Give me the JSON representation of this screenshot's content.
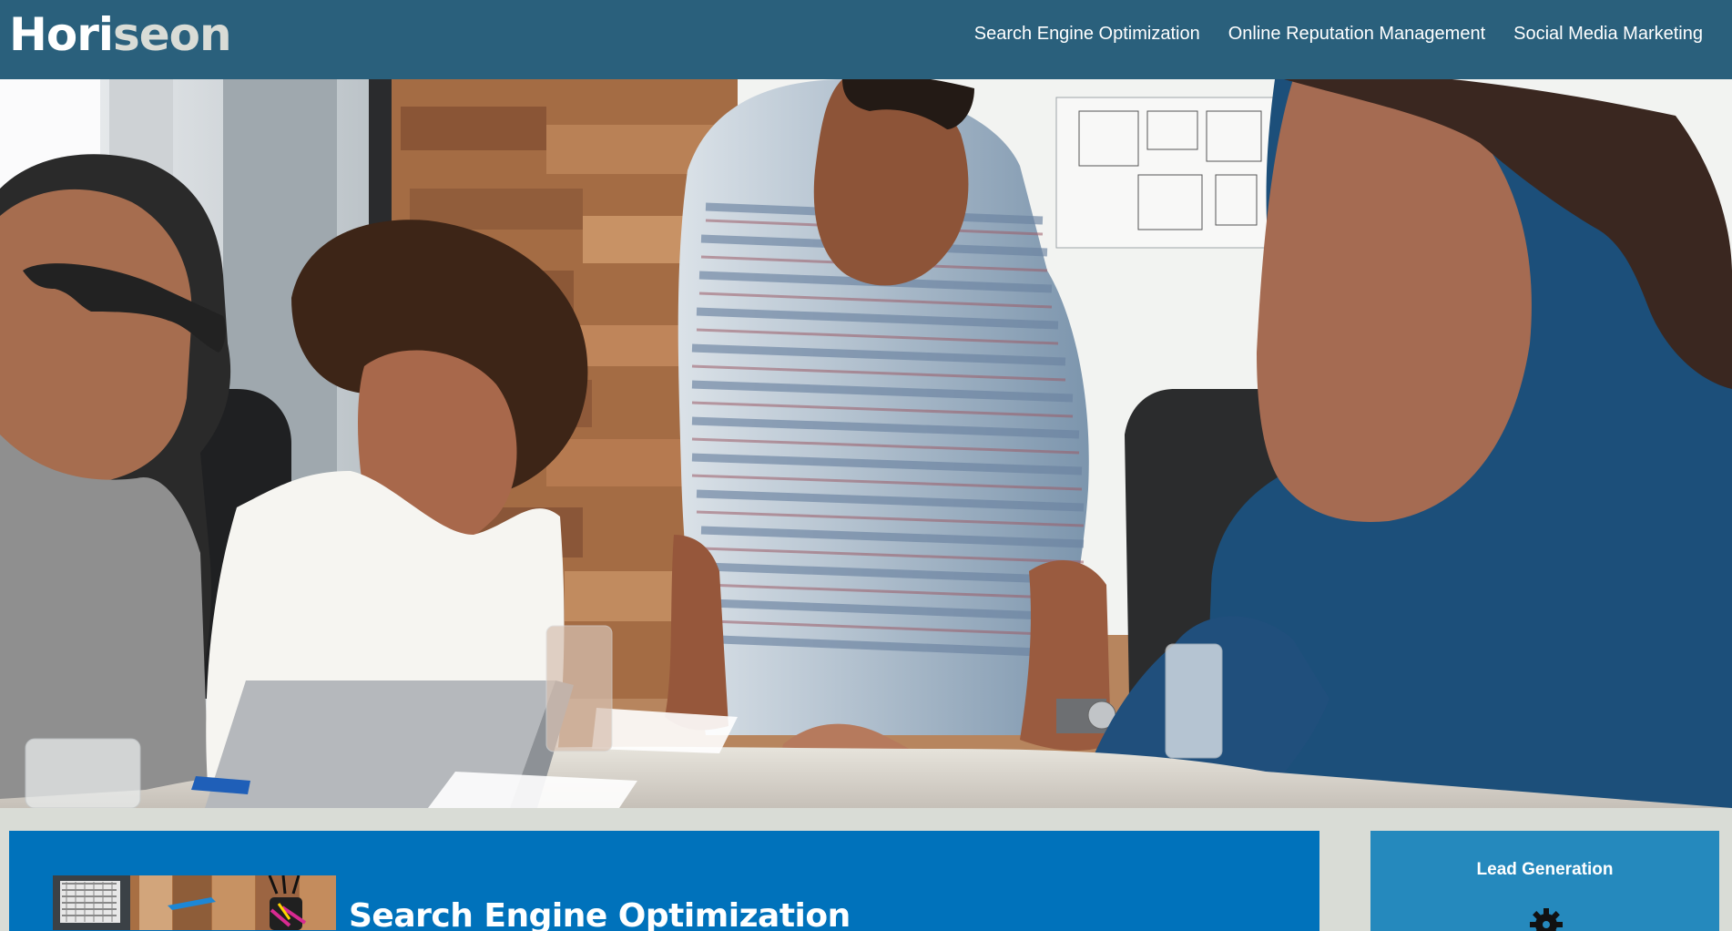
{
  "header": {
    "logo": {
      "main": "Hori",
      "accent": "seon"
    },
    "nav": [
      {
        "label": "Search Engine Optimization"
      },
      {
        "label": "Online Reputation Management"
      },
      {
        "label": "Social Media Marketing"
      }
    ]
  },
  "hero": {
    "image": "team-meeting-photo"
  },
  "content": {
    "title": "Search Engine Optimization",
    "image": "seo-desk-photo"
  },
  "aside": {
    "title": "Lead Generation",
    "icon": "gear-icon"
  },
  "colors": {
    "header_bg": "#2a607c",
    "content_bg": "#0072bb",
    "aside_bg": "#2589bd",
    "page_bg": "#d9dcd6"
  }
}
